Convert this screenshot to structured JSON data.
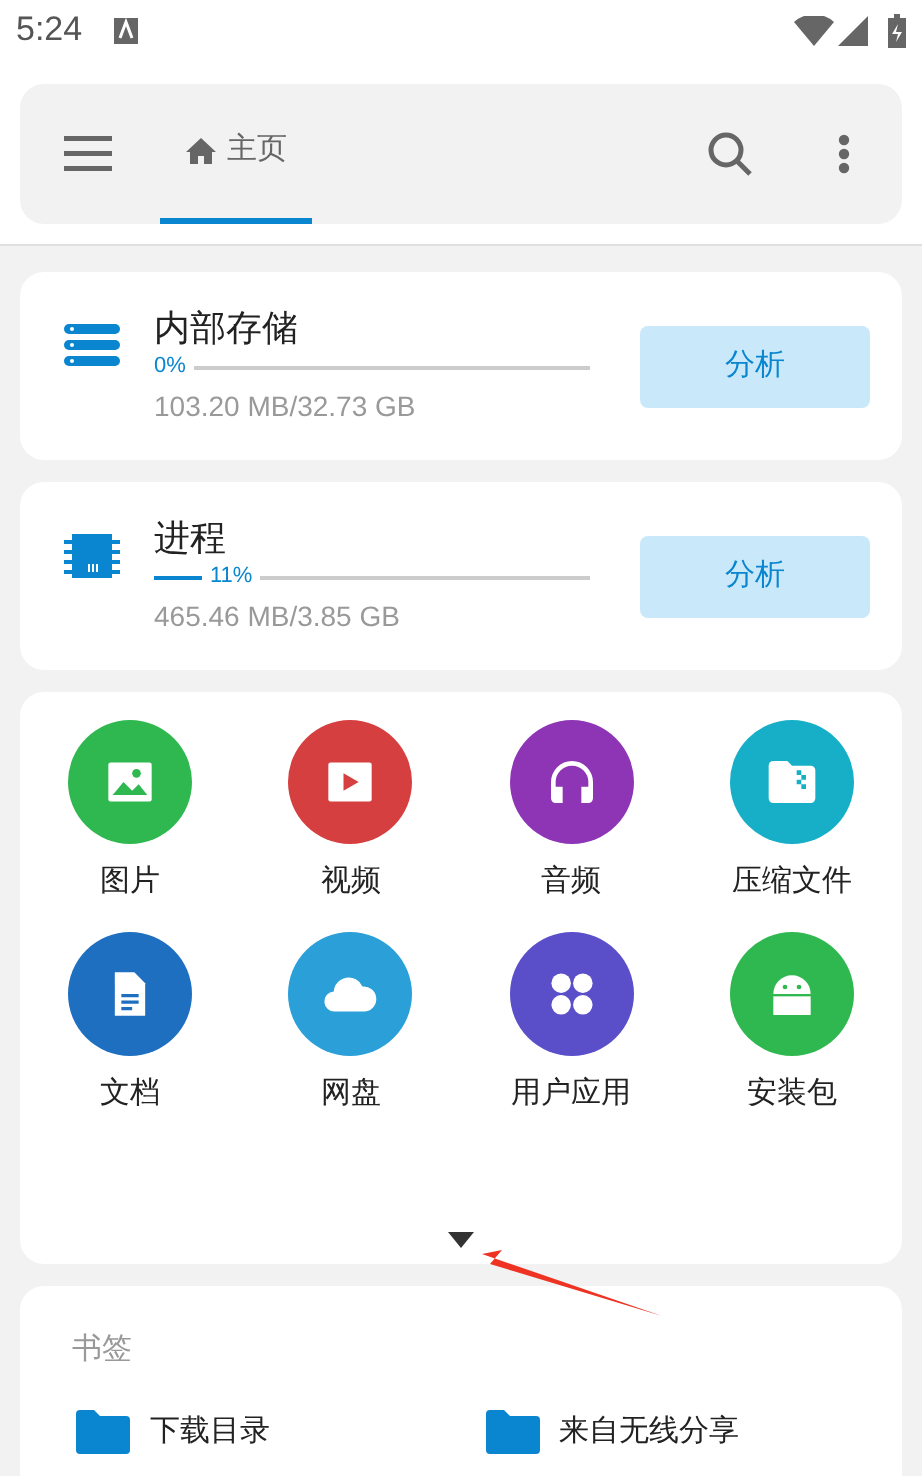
{
  "status_bar": {
    "time": "5:24"
  },
  "top_bar": {
    "tabs": [
      {
        "label": "主页",
        "selected": true
      }
    ]
  },
  "storage": [
    {
      "kind": "storage",
      "title": "内部存储",
      "percent": "0%",
      "usage": "103.20 MB/32.73 GB",
      "button": "分析"
    },
    {
      "kind": "process",
      "title": "进程",
      "percent": "11%",
      "level": 0.11,
      "usage": "465.46 MB/3.85 GB",
      "button": "分析"
    }
  ],
  "categories": [
    {
      "kind": "image",
      "label": "图片",
      "color": "#2fb84f"
    },
    {
      "kind": "video",
      "label": "视频",
      "color": "#d63f3f"
    },
    {
      "kind": "audio",
      "label": "音频",
      "color": "#8e35b6"
    },
    {
      "kind": "archive",
      "label": "压缩文件",
      "color": "#17afc8"
    },
    {
      "kind": "document",
      "label": "文档",
      "color": "#1e6fc0"
    },
    {
      "kind": "cloud",
      "label": "网盘",
      "color": "#2a9fd8"
    },
    {
      "kind": "apps",
      "label": "用户应用",
      "color": "#5b4fc9"
    },
    {
      "kind": "apk",
      "label": "安装包",
      "color": "#2fb84f"
    }
  ],
  "bookmarks": {
    "title": "书签",
    "items": [
      {
        "label": "下载目录"
      },
      {
        "label": "来自无线分享"
      }
    ]
  }
}
